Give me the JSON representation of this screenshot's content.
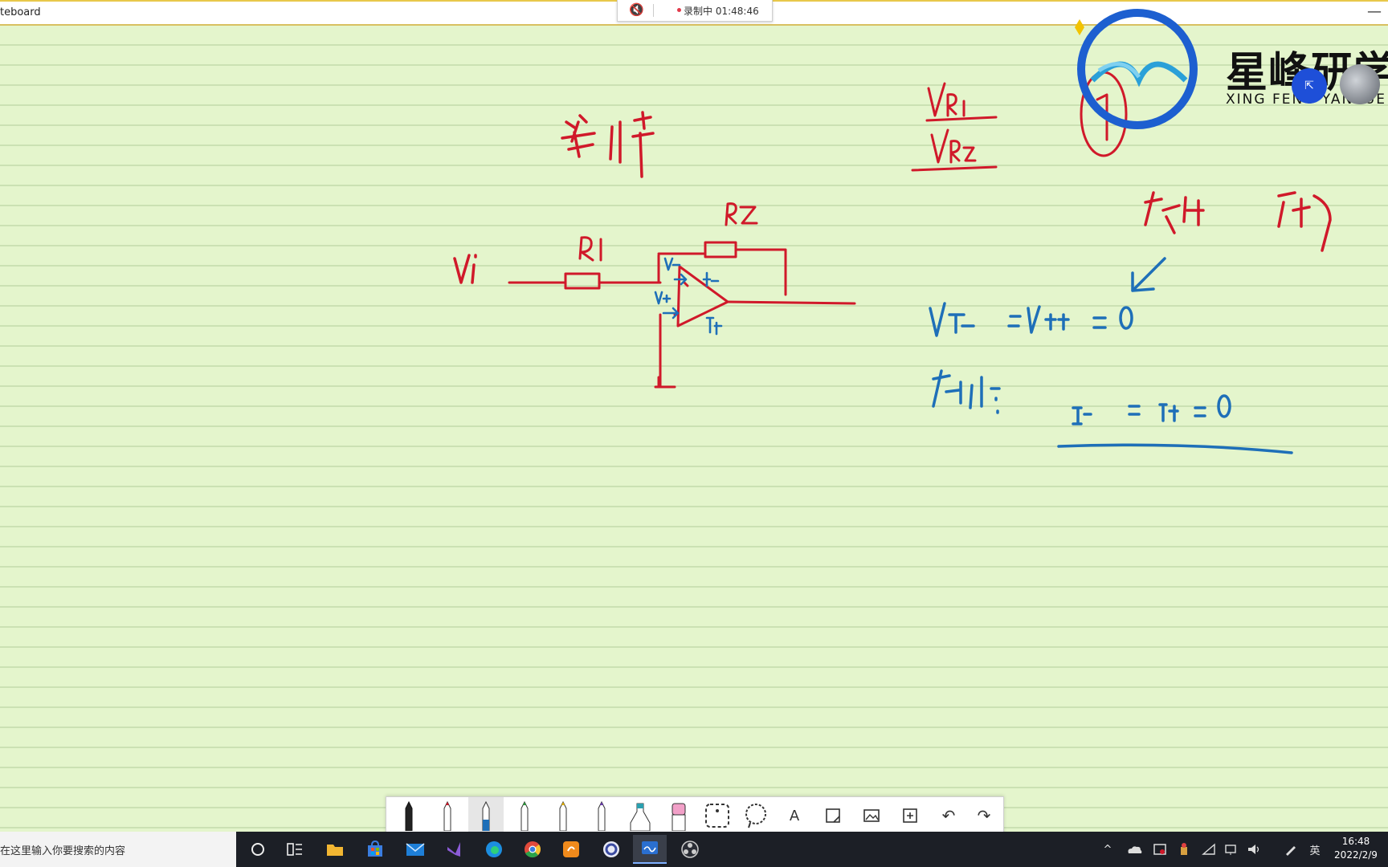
{
  "window": {
    "title": "teboard",
    "minimize_glyph": "—"
  },
  "recording": {
    "status": "录制中 01:48:46",
    "speaker_icon": "speaker-muted-icon"
  },
  "logo": {
    "cn": "星峰研学",
    "en": "XING FENG YANXUE"
  },
  "avatar": {
    "glyph": "⇱"
  },
  "canvas": {
    "colors": {
      "red": "#d0192a",
      "blue": "#1e6fb8",
      "paper": "#e4f5cc"
    }
  },
  "toolbar": {
    "tools": [
      {
        "name": "pen-black-tool",
        "glyph": ""
      },
      {
        "name": "pen-red-tool",
        "glyph": ""
      },
      {
        "name": "pen-blue-tool",
        "glyph": "",
        "active": true
      },
      {
        "name": "pen-green-tool",
        "glyph": ""
      },
      {
        "name": "pen-yellow-tool",
        "glyph": ""
      },
      {
        "name": "pen-purple-tool",
        "glyph": ""
      },
      {
        "name": "highlighter-tool",
        "glyph": ""
      },
      {
        "name": "eraser-tool",
        "glyph": ""
      },
      {
        "name": "select-tool",
        "glyph": ""
      },
      {
        "name": "lasso-tool",
        "glyph": ""
      },
      {
        "name": "text-tool",
        "glyph": "A"
      },
      {
        "name": "sticky-note-tool",
        "glyph": "□"
      },
      {
        "name": "image-tool",
        "glyph": "▭"
      },
      {
        "name": "add-tool",
        "glyph": "⊞"
      },
      {
        "name": "undo-tool",
        "glyph": "↶"
      },
      {
        "name": "redo-tool",
        "glyph": "↷"
      }
    ]
  },
  "taskbar": {
    "search_placeholder": "在这里输入你要搜索的内容",
    "apps": [
      {
        "name": "cortana-icon",
        "glyph": "○"
      },
      {
        "name": "task-view-icon",
        "glyph": "⧉"
      },
      {
        "name": "file-explorer-icon",
        "glyph": ""
      },
      {
        "name": "store-icon",
        "glyph": ""
      },
      {
        "name": "mail-icon",
        "glyph": ""
      },
      {
        "name": "visual-studio-icon",
        "glyph": ""
      },
      {
        "name": "edge-icon",
        "glyph": ""
      },
      {
        "name": "chrome-icon",
        "glyph": ""
      },
      {
        "name": "app-orange-icon",
        "glyph": ""
      },
      {
        "name": "app-circle-icon",
        "glyph": ""
      },
      {
        "name": "whiteboard-icon",
        "glyph": "",
        "active": true
      },
      {
        "name": "obs-icon",
        "glyph": ""
      }
    ],
    "tray": {
      "chevron": "^",
      "ime": "英",
      "time": "16:48",
      "date": "2022/2/9"
    }
  }
}
